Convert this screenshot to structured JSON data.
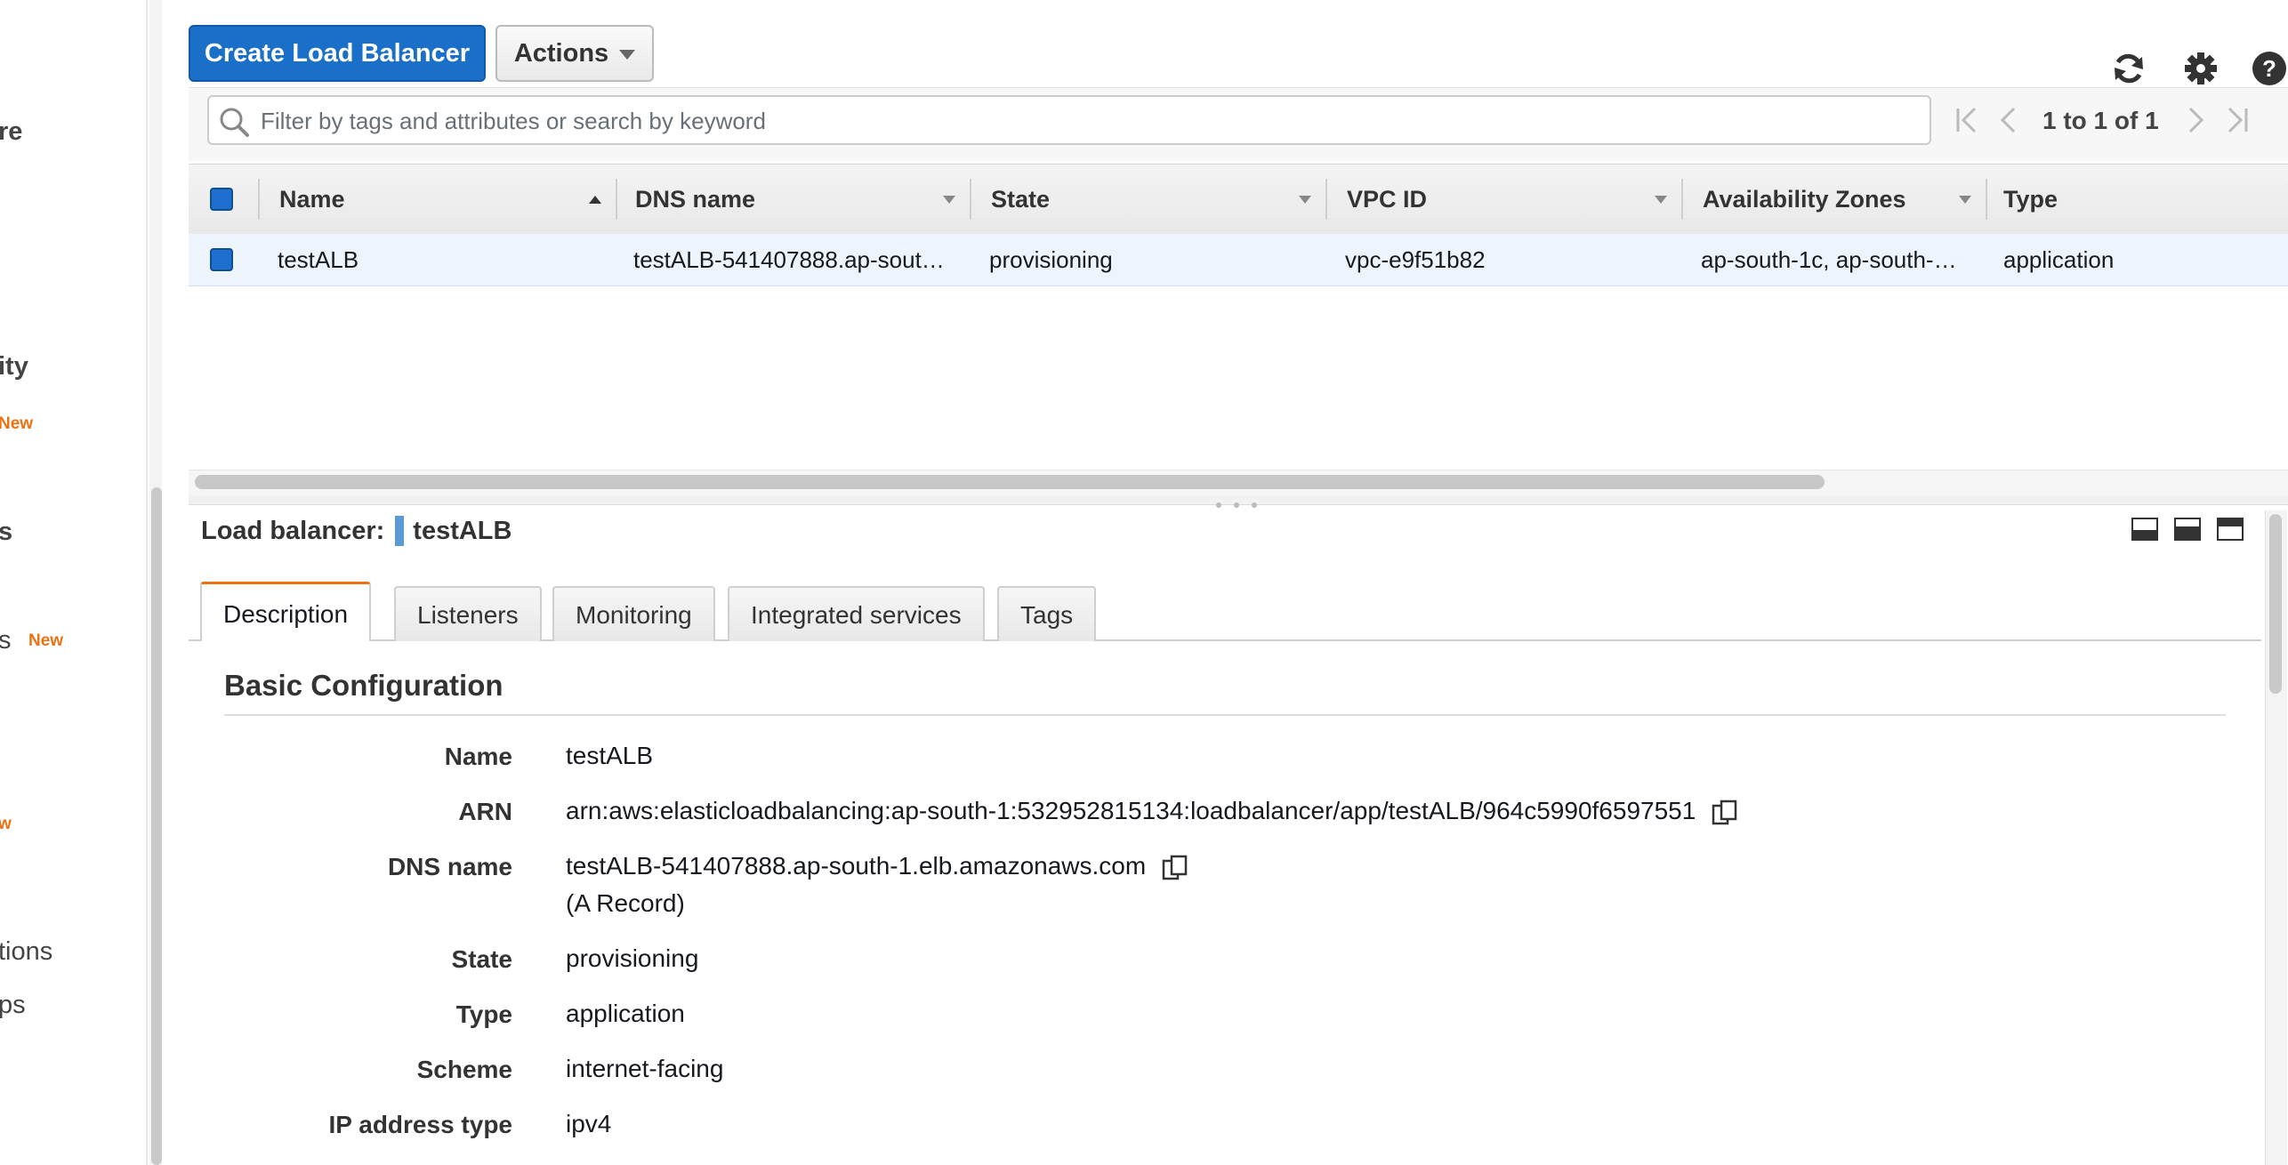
{
  "sidebar": {
    "items": [
      {
        "label": "re"
      },
      {
        "label": "ity"
      },
      {
        "label": "s"
      },
      {
        "label": "s"
      },
      {
        "label": "tions"
      },
      {
        "label": "ps"
      }
    ],
    "badges": [
      "New",
      "New",
      "w"
    ]
  },
  "toolbar": {
    "create_label": "Create Load Balancer",
    "actions_label": "Actions"
  },
  "search": {
    "placeholder": "Filter by tags and attributes or search by keyword",
    "value": ""
  },
  "pagination": {
    "text": "1 to 1 of 1"
  },
  "table": {
    "columns": [
      "Name",
      "DNS name",
      "State",
      "VPC ID",
      "Availability Zones",
      "Type"
    ],
    "rows": [
      {
        "name": "testALB",
        "dns_name": "testALB-541407888.ap-sout…",
        "state": "provisioning",
        "vpc_id": "vpc-e9f51b82",
        "availability_zones": "ap-south-1c, ap-south-…",
        "type": "application"
      }
    ]
  },
  "details": {
    "title_label": "Load balancer:",
    "title_name": "testALB",
    "tabs": [
      "Description",
      "Listeners",
      "Monitoring",
      "Integrated services",
      "Tags"
    ],
    "section_title": "Basic Configuration",
    "fields": [
      {
        "label": "Name",
        "value": "testALB"
      },
      {
        "label": "ARN",
        "value": "arn:aws:elasticloadbalancing:ap-south-1:532952815134:loadbalancer/app/testALB/964c5990f6597551"
      },
      {
        "label": "DNS name",
        "value": "testALB-541407888.ap-south-1.elb.amazonaws.com",
        "value2": "(A Record)"
      },
      {
        "label": "State",
        "value": "provisioning"
      },
      {
        "label": "Type",
        "value": "application"
      },
      {
        "label": "Scheme",
        "value": "internet-facing"
      },
      {
        "label": "IP address type",
        "value": "ipv4"
      }
    ]
  },
  "colors": {
    "primary": "#1a6fc8",
    "accent": "#ec7211",
    "row_selected": "#edf4fc"
  }
}
